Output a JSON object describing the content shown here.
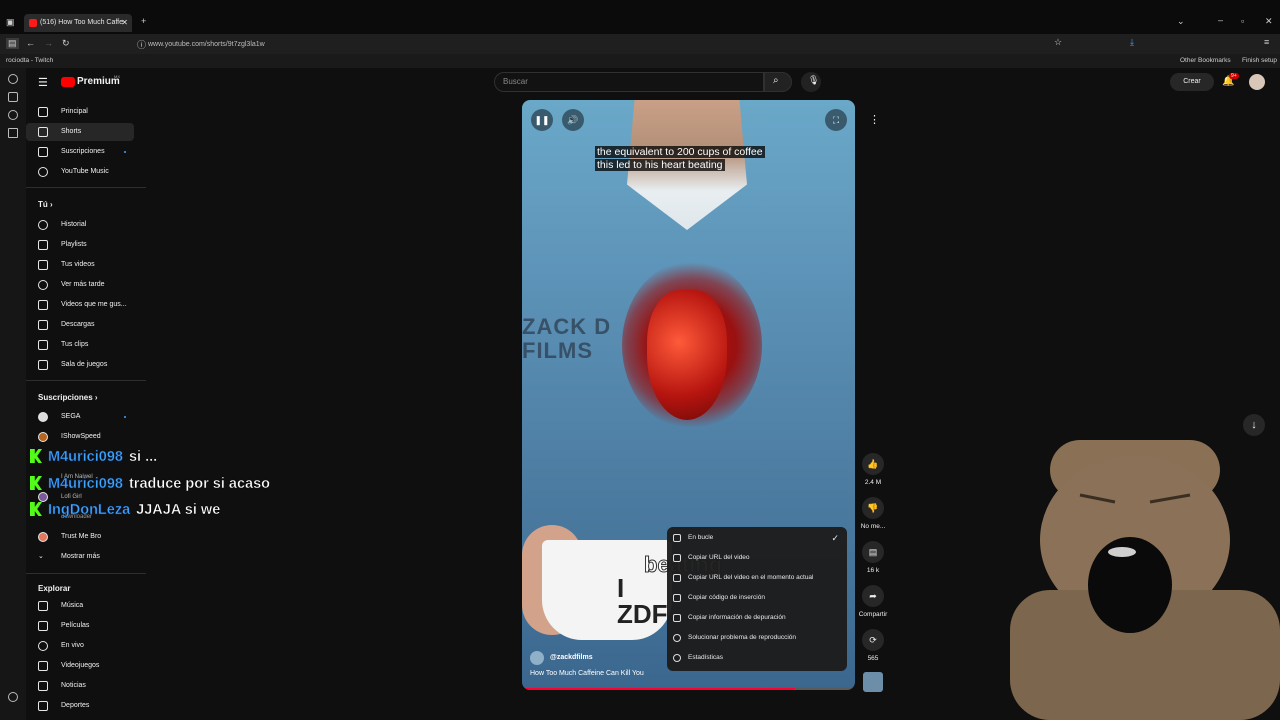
{
  "browser": {
    "tab_title": "(516) How Too Much Caffe",
    "url": "www.youtube.com/shorts/9t7zgl3la1w",
    "bookmark": "rociodta - Twitch",
    "other_bookmarks": "Other Bookmarks",
    "finish_setup": "Finish setup"
  },
  "youtube": {
    "logo_text": "Premium",
    "region": "MX",
    "search_placeholder": "Buscar",
    "create_label": "Crear",
    "notif_badge": "9+"
  },
  "sidebar": {
    "main": [
      {
        "label": "Principal",
        "icon": "home-icon"
      },
      {
        "label": "Shorts",
        "icon": "shorts-icon"
      },
      {
        "label": "Suscripciones",
        "icon": "subscriptions-icon"
      },
      {
        "label": "YouTube Music",
        "icon": "music-icon"
      }
    ],
    "you_heading": "Tú",
    "you": [
      {
        "label": "Historial",
        "icon": "history-icon"
      },
      {
        "label": "Playlists",
        "icon": "playlists-icon"
      },
      {
        "label": "Tus videos",
        "icon": "videos-icon"
      },
      {
        "label": "Ver más tarde",
        "icon": "clock-icon"
      },
      {
        "label": "Videos que me gus...",
        "icon": "like-icon"
      },
      {
        "label": "Descargas",
        "icon": "download-icon"
      },
      {
        "label": "Tus clips",
        "icon": "clips-icon"
      },
      {
        "label": "Sala de juegos",
        "icon": "games-icon"
      }
    ],
    "subs_heading": "Suscripciones",
    "subs": [
      {
        "label": "SEGA"
      },
      {
        "label": "IShowSpeed"
      },
      {
        "label": "I Am Naiwel"
      },
      {
        "label": "Lofi Girl"
      },
      {
        "label": "downloader"
      },
      {
        "label": "Trust Me Bro"
      }
    ],
    "show_more": "Mostrar más",
    "explore_heading": "Explorar",
    "explore": [
      {
        "label": "Música",
        "icon": "music-note-icon"
      },
      {
        "label": "Películas",
        "icon": "film-icon"
      },
      {
        "label": "En vivo",
        "icon": "live-icon"
      },
      {
        "label": "Videojuegos",
        "icon": "gamepad-icon"
      },
      {
        "label": "Noticias",
        "icon": "news-icon"
      },
      {
        "label": "Deportes",
        "icon": "trophy-icon"
      }
    ]
  },
  "video": {
    "caption_line1": "the equivalent to 200 cups of coffee",
    "caption_line2": "this led to his heart beating",
    "brand_text": "ZACK D FILMS",
    "cup_text": "I ZDF",
    "channel": "@zackdfilms",
    "title": "How Too Much Caffeine Can Kill You",
    "burned_caption": "beating",
    "progress": 0.82
  },
  "actions": {
    "likes": "2.4 M",
    "dislike": "No me...",
    "comments": "16 k",
    "share": "Compartir",
    "remix": "565"
  },
  "context_menu": [
    {
      "label": "En bucle",
      "checked": true
    },
    {
      "label": "Copiar URL del video"
    },
    {
      "label": "Copiar URL del video en el momento actual"
    },
    {
      "label": "Copiar código de inserción"
    },
    {
      "label": "Copiar información de depuración"
    },
    {
      "label": "Solucionar problema de reproducción"
    },
    {
      "label": "Estadísticas"
    }
  ],
  "chat": [
    {
      "user": "M4urici098",
      "message": "si ..."
    },
    {
      "user": "M4urici098",
      "message": "traduce por si acaso"
    },
    {
      "user": "IngDonLeza",
      "message": "JJAJA si we"
    }
  ]
}
